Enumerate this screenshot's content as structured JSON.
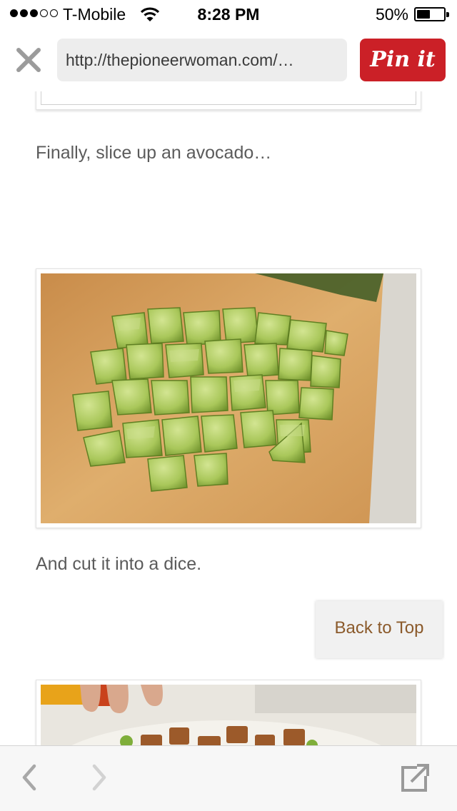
{
  "status_bar": {
    "carrier": "T-Mobile",
    "time": "8:28 PM",
    "battery_percent": "50%",
    "battery_level": 0.5,
    "signal_bars": 3,
    "signal_total": 5
  },
  "top_bar": {
    "url": "http://thepioneerwoman.com/…",
    "pin_label": "Pin it",
    "pin_color": "#cb2027"
  },
  "article": {
    "paragraph1": "Finally, slice up an avocado…",
    "paragraph2": "And cut it into a dice."
  },
  "back_to_top": "Back to Top",
  "icons": {
    "close": "close-icon",
    "back": "chevron-left-icon",
    "forward": "chevron-right-icon",
    "share": "open-external-icon"
  }
}
